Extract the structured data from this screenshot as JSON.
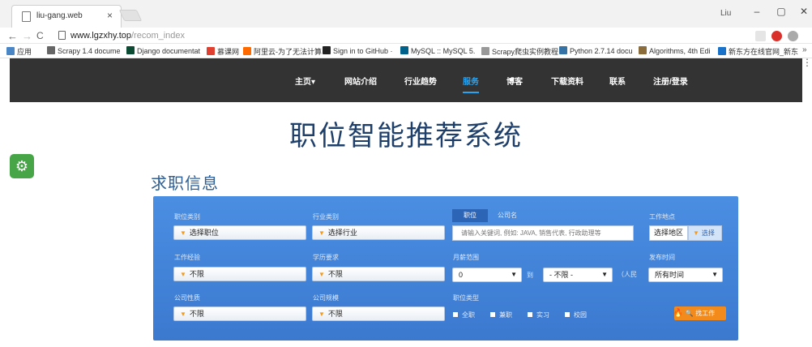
{
  "browser": {
    "tab_title": "liu-gang.web",
    "tab_close": "×",
    "window_user": "Liu",
    "minimize": "–",
    "maximize": "▢",
    "close": "✕",
    "back": "←",
    "forward": "→",
    "reload": "C",
    "url_host": "www.lgzxhy.top",
    "url_path": "/recom_index",
    "menu": "⋮",
    "bookmarks": [
      {
        "label": "应用",
        "color": "#4a86c5"
      },
      {
        "label": "Scrapy 1.4 docume",
        "color": "#666666"
      },
      {
        "label": "Django documentat",
        "color": "#0c4b33"
      },
      {
        "label": "慕课网",
        "color": "#e0402f"
      },
      {
        "label": "阿里云-为了无法计算",
        "color": "#ff6a00"
      },
      {
        "label": "Sign in to GitHub ·",
        "color": "#222222"
      },
      {
        "label": "MySQL :: MySQL 5.",
        "color": "#00618a"
      },
      {
        "label": "Scrapy爬虫实例教程",
        "color": "#999999"
      },
      {
        "label": "Python 2.7.14 docu",
        "color": "#3572a5"
      },
      {
        "label": "Algorithms, 4th Edi",
        "color": "#8a6d3b"
      },
      {
        "label": "新东方在线官网_新东",
        "color": "#1a73c8"
      }
    ],
    "bookmarks_overflow": "»"
  },
  "nav": {
    "items": [
      {
        "label": "主页▾",
        "active": false
      },
      {
        "label": "网站介绍",
        "active": false
      },
      {
        "label": "行业趋势",
        "active": false
      },
      {
        "label": "服务",
        "active": true
      },
      {
        "label": "博客",
        "active": false
      },
      {
        "label": "下载资料",
        "active": false
      },
      {
        "label": "联系",
        "active": false
      },
      {
        "label": "注册/登录",
        "active": false
      }
    ]
  },
  "page": {
    "title": "职位智能推荐系统",
    "gear_icon": "⚙",
    "section_title": "求职信息"
  },
  "form": {
    "job_category": {
      "label": "职位类别",
      "value": "选择职位"
    },
    "industry": {
      "label": "行业类别",
      "value": "选择行业"
    },
    "search_tabs": {
      "position": "职位",
      "company": "公司名"
    },
    "keyword_placeholder": "请输入关键词, 例如: JAVA, 销售代表, 行政助理等",
    "location": {
      "label": "工作地点",
      "button": "选择地区",
      "pick": "选择"
    },
    "experience": {
      "label": "工作经验",
      "value": "不限"
    },
    "education": {
      "label": "学历要求",
      "value": "不限"
    },
    "salary": {
      "label": "月薪范围",
      "min": "0",
      "to": "到",
      "max": "- 不限 -",
      "unit": "（人民"
    },
    "post_time": {
      "label": "发布时间",
      "value": "所有时间"
    },
    "company_type": {
      "label": "公司性质",
      "value": "不限"
    },
    "company_size": {
      "label": "公司规模",
      "value": "不限"
    },
    "job_type": {
      "label": "职位类型",
      "options": [
        "全职",
        "兼职",
        "实习",
        "校园"
      ]
    },
    "search_button": "找工作"
  },
  "colors": {
    "nav_bg": "#333333",
    "nav_active": "#27a4f2",
    "panel_blue": "#4a8ee2",
    "accent_orange": "#f28a1c",
    "gear_green": "#47a547"
  }
}
